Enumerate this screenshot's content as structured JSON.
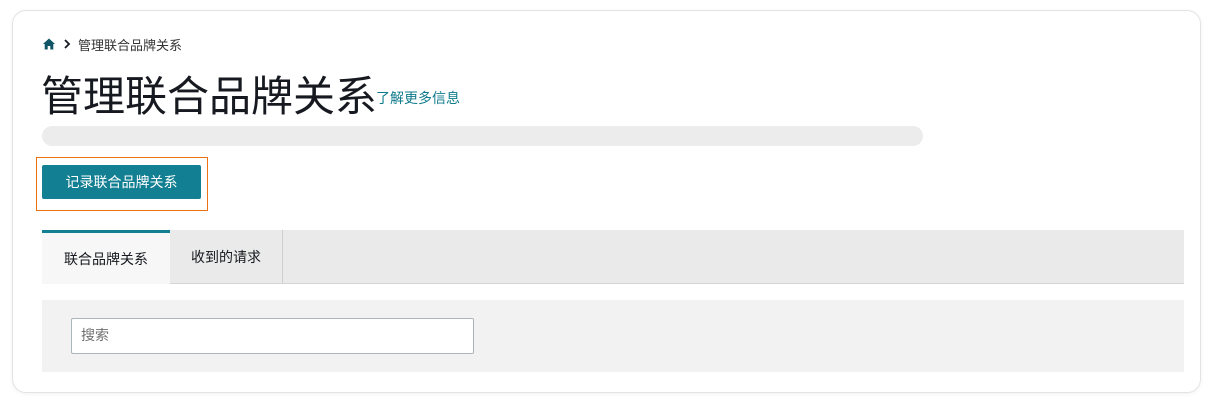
{
  "breadcrumb": {
    "home_icon": "home-icon",
    "separator_icon": "chevron-right-icon",
    "current": "管理联合品牌关系"
  },
  "header": {
    "title": "管理联合品牌关系",
    "learn_more": "了解更多信息"
  },
  "actions": {
    "record_button": "记录联合品牌关系"
  },
  "tabs": [
    {
      "label": "联合品牌关系",
      "active": true
    },
    {
      "label": "收到的请求",
      "active": false
    }
  ],
  "search": {
    "placeholder": "搜索",
    "value": ""
  },
  "colors": {
    "accent": "#137f92",
    "link": "#0f7b8c",
    "focus_outline": "#ec7211"
  }
}
